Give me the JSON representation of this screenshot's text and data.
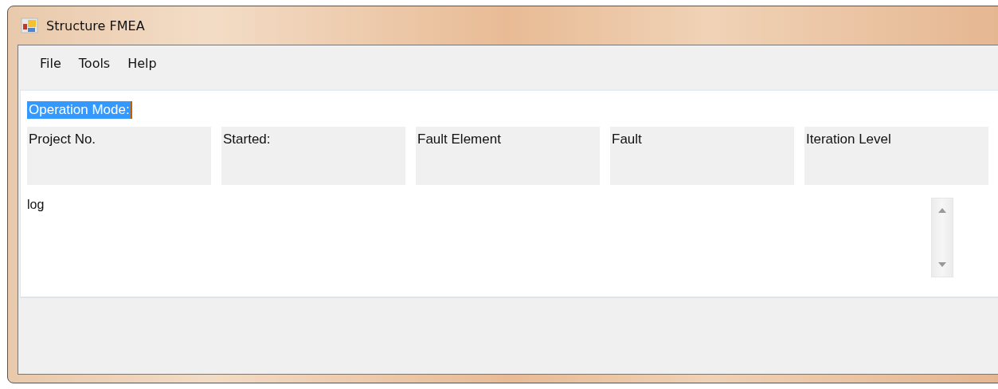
{
  "window": {
    "title": "Structure FMEA"
  },
  "menu": [
    {
      "label": "File"
    },
    {
      "label": "Tools"
    },
    {
      "label": "Help"
    }
  ],
  "operation_mode": {
    "label": "Operation Mode:",
    "selected": true
  },
  "info_fields": [
    {
      "label": "Project No."
    },
    {
      "label": "Started:"
    },
    {
      "label": "Fault Element"
    },
    {
      "label": "Fault"
    },
    {
      "label": "Iteration Level"
    }
  ],
  "log": {
    "text": "log"
  }
}
